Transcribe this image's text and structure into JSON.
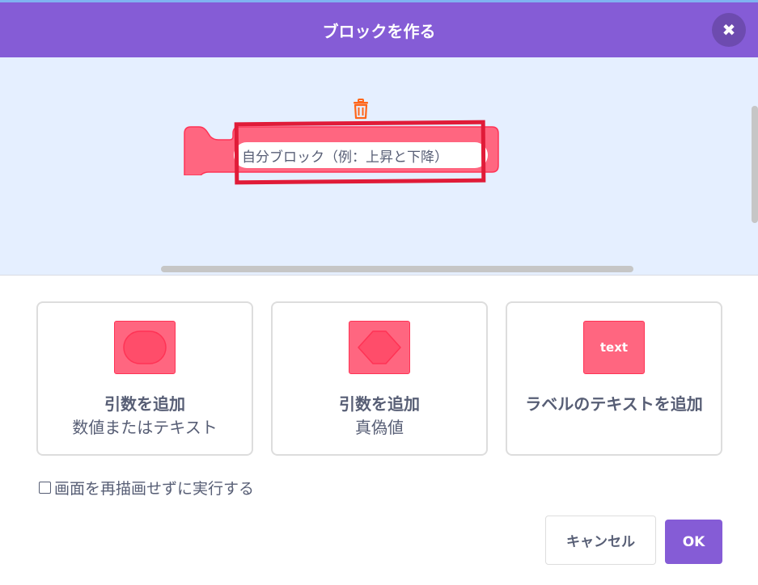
{
  "dialog": {
    "title": "ブロックを作る",
    "close_icon": "close-icon"
  },
  "workspace": {
    "block_name_value": "自分ブロック（例：上昇と下降）",
    "trash_icon": "trash-icon",
    "block_color": "#ff6680"
  },
  "options": [
    {
      "title": "引数を追加",
      "subtitle": "数値またはテキスト",
      "icon": "round-input-icon"
    },
    {
      "title": "引数を追加",
      "subtitle": "真偽値",
      "icon": "hexagon-input-icon"
    },
    {
      "title": "ラベルのテキストを追加",
      "icon": "text-label-icon",
      "icon_text": "text"
    }
  ],
  "checkbox": {
    "label": "画面を再描画せずに実行する",
    "checked": false
  },
  "buttons": {
    "cancel": "キャンセル",
    "ok": "OK"
  },
  "colors": {
    "header": "#855cd6",
    "workspace_bg": "#e5efff",
    "highlight": "#e01b38"
  }
}
